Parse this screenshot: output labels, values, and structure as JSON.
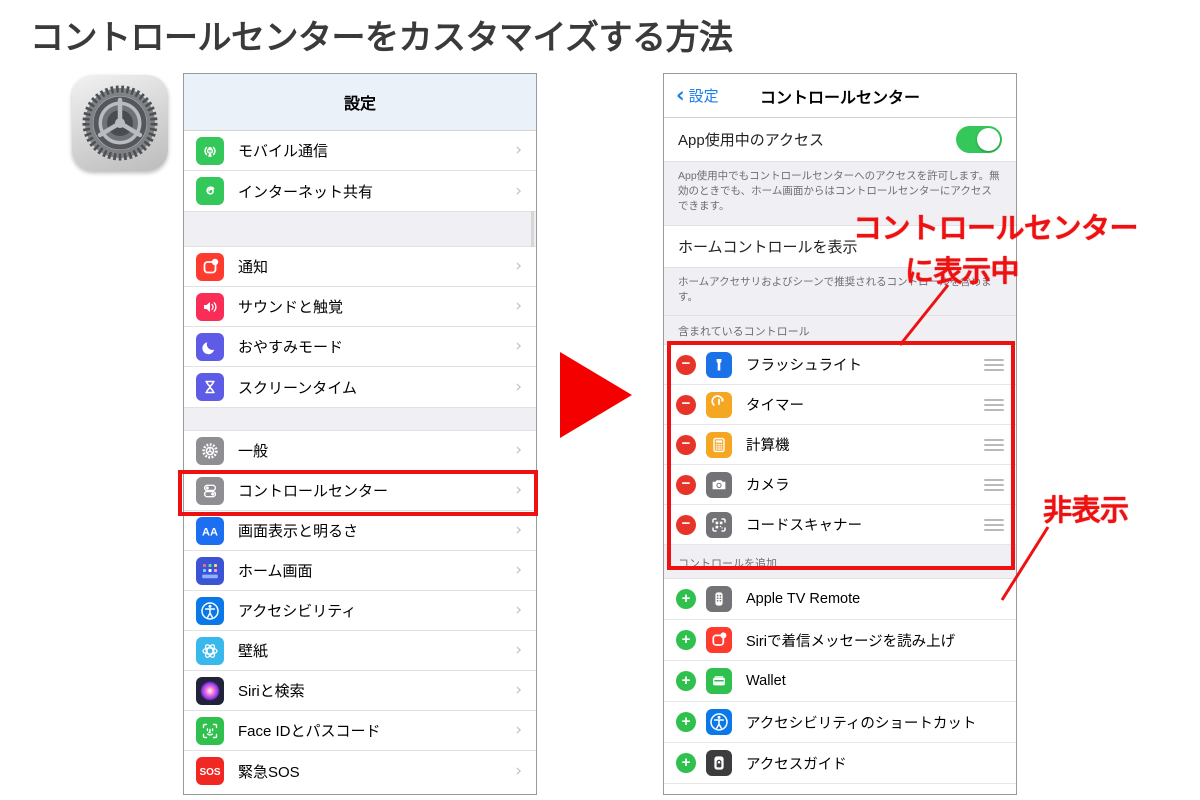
{
  "page": {
    "title": "コントロールセンターをカスタマイズする方法"
  },
  "app_icon": {
    "name": "settings-gear-icon"
  },
  "left_phone": {
    "nav_title": "設定",
    "groups": [
      {
        "items": [
          {
            "label": "モバイル通信",
            "icon": "cellular-icon",
            "color": "#34c759"
          },
          {
            "label": "インターネット共有",
            "icon": "hotspot-icon",
            "color": "#34c759"
          }
        ]
      },
      {
        "items": [
          {
            "label": "通知",
            "icon": "notifications-icon",
            "color": "#ff3b30"
          },
          {
            "label": "サウンドと触覚",
            "icon": "sounds-haptics-icon",
            "color": "#fa2d56"
          },
          {
            "label": "おやすみモード",
            "icon": "do-not-disturb-moon-icon",
            "color": "#5e5ce6"
          },
          {
            "label": "スクリーンタイム",
            "icon": "screen-time-hourglass-icon",
            "color": "#5e5ce6"
          }
        ]
      },
      {
        "items": [
          {
            "label": "一般",
            "icon": "general-gear-icon",
            "color": "#8e8e93"
          },
          {
            "label": "コントロールセンター",
            "icon": "control-center-icon",
            "color": "#8e8e93",
            "highlighted": true
          },
          {
            "label": "画面表示と明るさ",
            "icon": "display-brightness-aa-icon",
            "color": "#1b6ff0"
          },
          {
            "label": "ホーム画面",
            "icon": "home-screen-grid-icon",
            "color": "#3b54d6"
          },
          {
            "label": "アクセシビリティ",
            "icon": "accessibility-icon",
            "color": "#0a78e8"
          },
          {
            "label": "壁紙",
            "icon": "wallpaper-icon",
            "color": "#39b8ec"
          },
          {
            "label": "Siriと検索",
            "icon": "siri-search-icon",
            "color": "#22223a"
          },
          {
            "label": "Face IDとパスコード",
            "icon": "face-id-icon",
            "color": "#2fc04e"
          },
          {
            "label": "緊急SOS",
            "icon": "emergency-sos-icon",
            "color": "#f02722"
          }
        ]
      }
    ],
    "chevron": "›"
  },
  "right_phone": {
    "back_label": "設定",
    "back_chevron": "‹",
    "nav_title": "コントロールセンター",
    "access_toggle": {
      "label": "App使用中のアクセス",
      "state": "on",
      "color": "#34c759"
    },
    "access_footnote": "App使用中でもコントロールセンターへのアクセスを許可します。無効のときでも、ホーム画面からはコントロールセンターにアクセスできます。",
    "home_controls": {
      "label": "ホームコントロールを表示"
    },
    "home_controls_footnote": "ホームアクセサリおよびシーンで推奨されるコントロールを含めます。",
    "included_header": "含まれているコントロール",
    "included": [
      {
        "label": "フラッシュライト",
        "icon": "flashlight-icon",
        "color": "#1b72e8",
        "action": "remove"
      },
      {
        "label": "タイマー",
        "icon": "timer-icon",
        "color": "#f5a623",
        "action": "remove"
      },
      {
        "label": "計算機",
        "icon": "calculator-icon",
        "color": "#f5a623",
        "action": "remove"
      },
      {
        "label": "カメラ",
        "icon": "camera-icon",
        "color": "#737377",
        "action": "remove"
      },
      {
        "label": "コードスキャナー",
        "icon": "code-scanner-icon",
        "color": "#737377",
        "action": "remove"
      }
    ],
    "add_header": "コントロールを追加",
    "available": [
      {
        "label": "Apple TV Remote",
        "icon": "apple-tv-remote-icon",
        "color": "#737377",
        "action": "add"
      },
      {
        "label": "Siriで着信メッセージを読み上げ",
        "icon": "announce-messages-icon",
        "color": "#ff3b30",
        "action": "add"
      },
      {
        "label": "Wallet",
        "icon": "wallet-icon",
        "color": "#2fc04e",
        "action": "add"
      },
      {
        "label": "アクセシビリティのショートカット",
        "icon": "accessibility-shortcut-icon",
        "color": "#0a78e8",
        "action": "add"
      },
      {
        "label": "アクセスガイド",
        "icon": "guided-access-icon",
        "color": "#3c3c3e",
        "action": "add"
      }
    ],
    "remove_badge": "−",
    "add_badge": "+"
  },
  "annotations": {
    "shown_line1": "コントロールセンター",
    "shown_line2": "に表示中",
    "hidden": "非表示",
    "accent_color": "#ee1111",
    "arrow": "right-triangle-arrow"
  }
}
